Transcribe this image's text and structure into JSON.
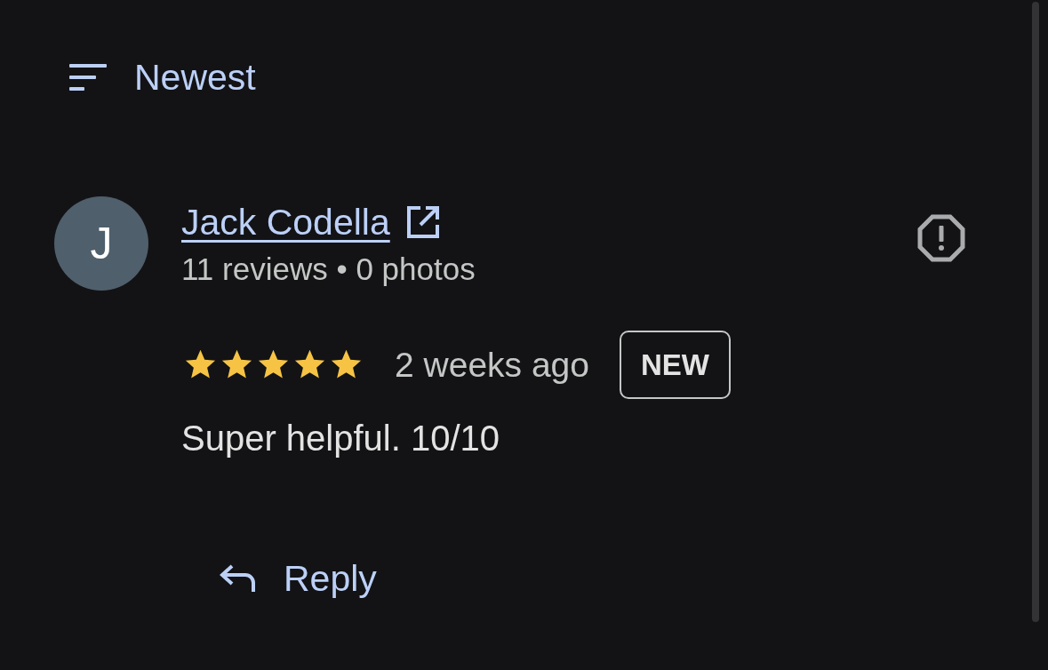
{
  "sort": {
    "label": "Newest"
  },
  "review": {
    "avatar_letter": "J",
    "author": "Jack Codella",
    "meta": "11 reviews • 0 photos",
    "stars": 5,
    "time": "2 weeks ago",
    "badge": "NEW",
    "text": "Super helpful. 10/10"
  },
  "actions": [
    {
      "kind": "reply",
      "label": "Reply"
    }
  ]
}
